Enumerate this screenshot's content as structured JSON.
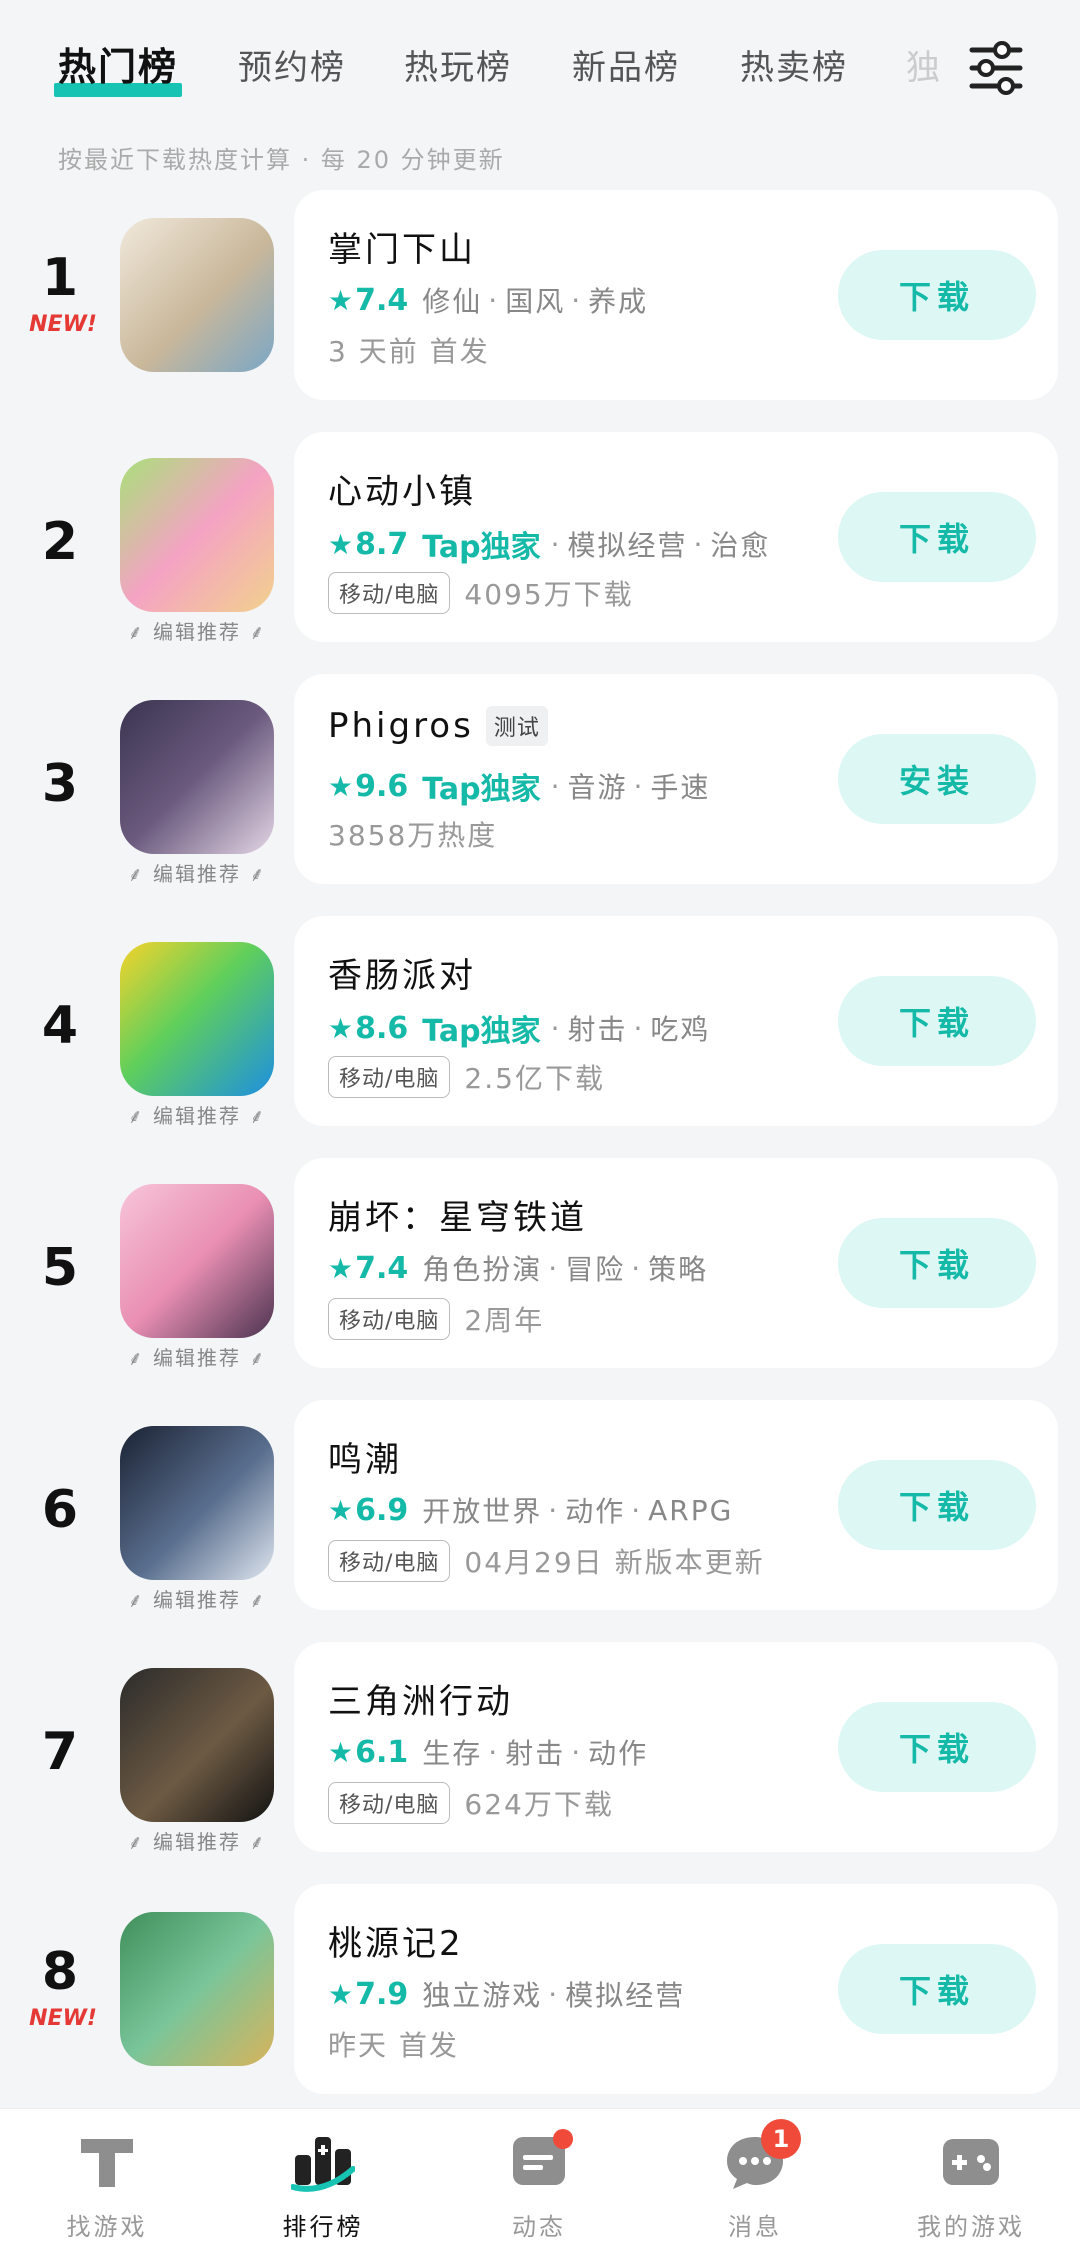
{
  "tabs": [
    {
      "label": "热门榜",
      "active": true
    },
    {
      "label": "预约榜"
    },
    {
      "label": "热玩榜"
    },
    {
      "label": "新品榜"
    },
    {
      "label": "热卖榜"
    },
    {
      "label": "独"
    }
  ],
  "subtitle": "按最近下载热度计算 · 每 20 分钟更新",
  "editor_pick_label": "编辑推荐",
  "new_label": "NEW!",
  "tap_label": "Tap独家",
  "star_glyph": "★",
  "games": [
    {
      "rank": "1",
      "is_new": true,
      "title": "掌门下山",
      "score": "7.4",
      "tags": [
        "修仙",
        "国风",
        "养成"
      ],
      "platform": "",
      "sub": "3 天前 首发",
      "action": "下载",
      "editor_pick": false
    },
    {
      "rank": "2",
      "is_new": false,
      "title": "心动小镇",
      "score": "8.7",
      "tap": true,
      "tags": [
        "模拟经营",
        "治愈"
      ],
      "platform": "移动/电脑",
      "sub": "4095万下载",
      "action": "下载",
      "editor_pick": true
    },
    {
      "rank": "3",
      "is_new": false,
      "title": "Phigros",
      "badge": "测试",
      "score": "9.6",
      "tap": true,
      "tags": [
        "音游",
        "手速"
      ],
      "platform": "",
      "sub": "3858万热度",
      "action": "安装",
      "editor_pick": true
    },
    {
      "rank": "4",
      "is_new": false,
      "title": "香肠派对",
      "score": "8.6",
      "tap": true,
      "tags": [
        "射击",
        "吃鸡"
      ],
      "platform": "移动/电脑",
      "sub": "2.5亿下载",
      "action": "下载",
      "editor_pick": true
    },
    {
      "rank": "5",
      "is_new": false,
      "title": "崩坏：星穹铁道",
      "score": "7.4",
      "tags": [
        "角色扮演",
        "冒险",
        "策略"
      ],
      "platform": "移动/电脑",
      "sub": "2周年",
      "action": "下载",
      "editor_pick": true
    },
    {
      "rank": "6",
      "is_new": false,
      "title": "鸣潮",
      "score": "6.9",
      "tags": [
        "开放世界",
        "动作",
        "ARPG"
      ],
      "platform": "移动/电脑",
      "sub": "04月29日 新版本更新",
      "action": "下载",
      "editor_pick": true
    },
    {
      "rank": "7",
      "is_new": false,
      "title": "三角洲行动",
      "score": "6.1",
      "tags": [
        "生存",
        "射击",
        "动作"
      ],
      "platform": "移动/电脑",
      "sub": "624万下载",
      "action": "下载",
      "editor_pick": true
    },
    {
      "rank": "8",
      "is_new": true,
      "title": "桃源记2",
      "score": "7.9",
      "tags": [
        "独立游戏",
        "模拟经营"
      ],
      "platform": "",
      "sub": "昨天 首发",
      "action": "下载",
      "editor_pick": false
    }
  ],
  "bottom_nav": [
    {
      "label": "找游戏",
      "icon": "tap-logo-icon"
    },
    {
      "label": "排行榜",
      "icon": "ranking-icon",
      "active": true
    },
    {
      "label": "动态",
      "icon": "feed-icon",
      "dot": true
    },
    {
      "label": "消息",
      "icon": "message-icon",
      "badge": "1"
    },
    {
      "label": "我的游戏",
      "icon": "gamepad-icon"
    }
  ],
  "colors": {
    "accent": "#17c3b2",
    "new_red": "#e53935",
    "badge_red": "#f04a3a"
  }
}
